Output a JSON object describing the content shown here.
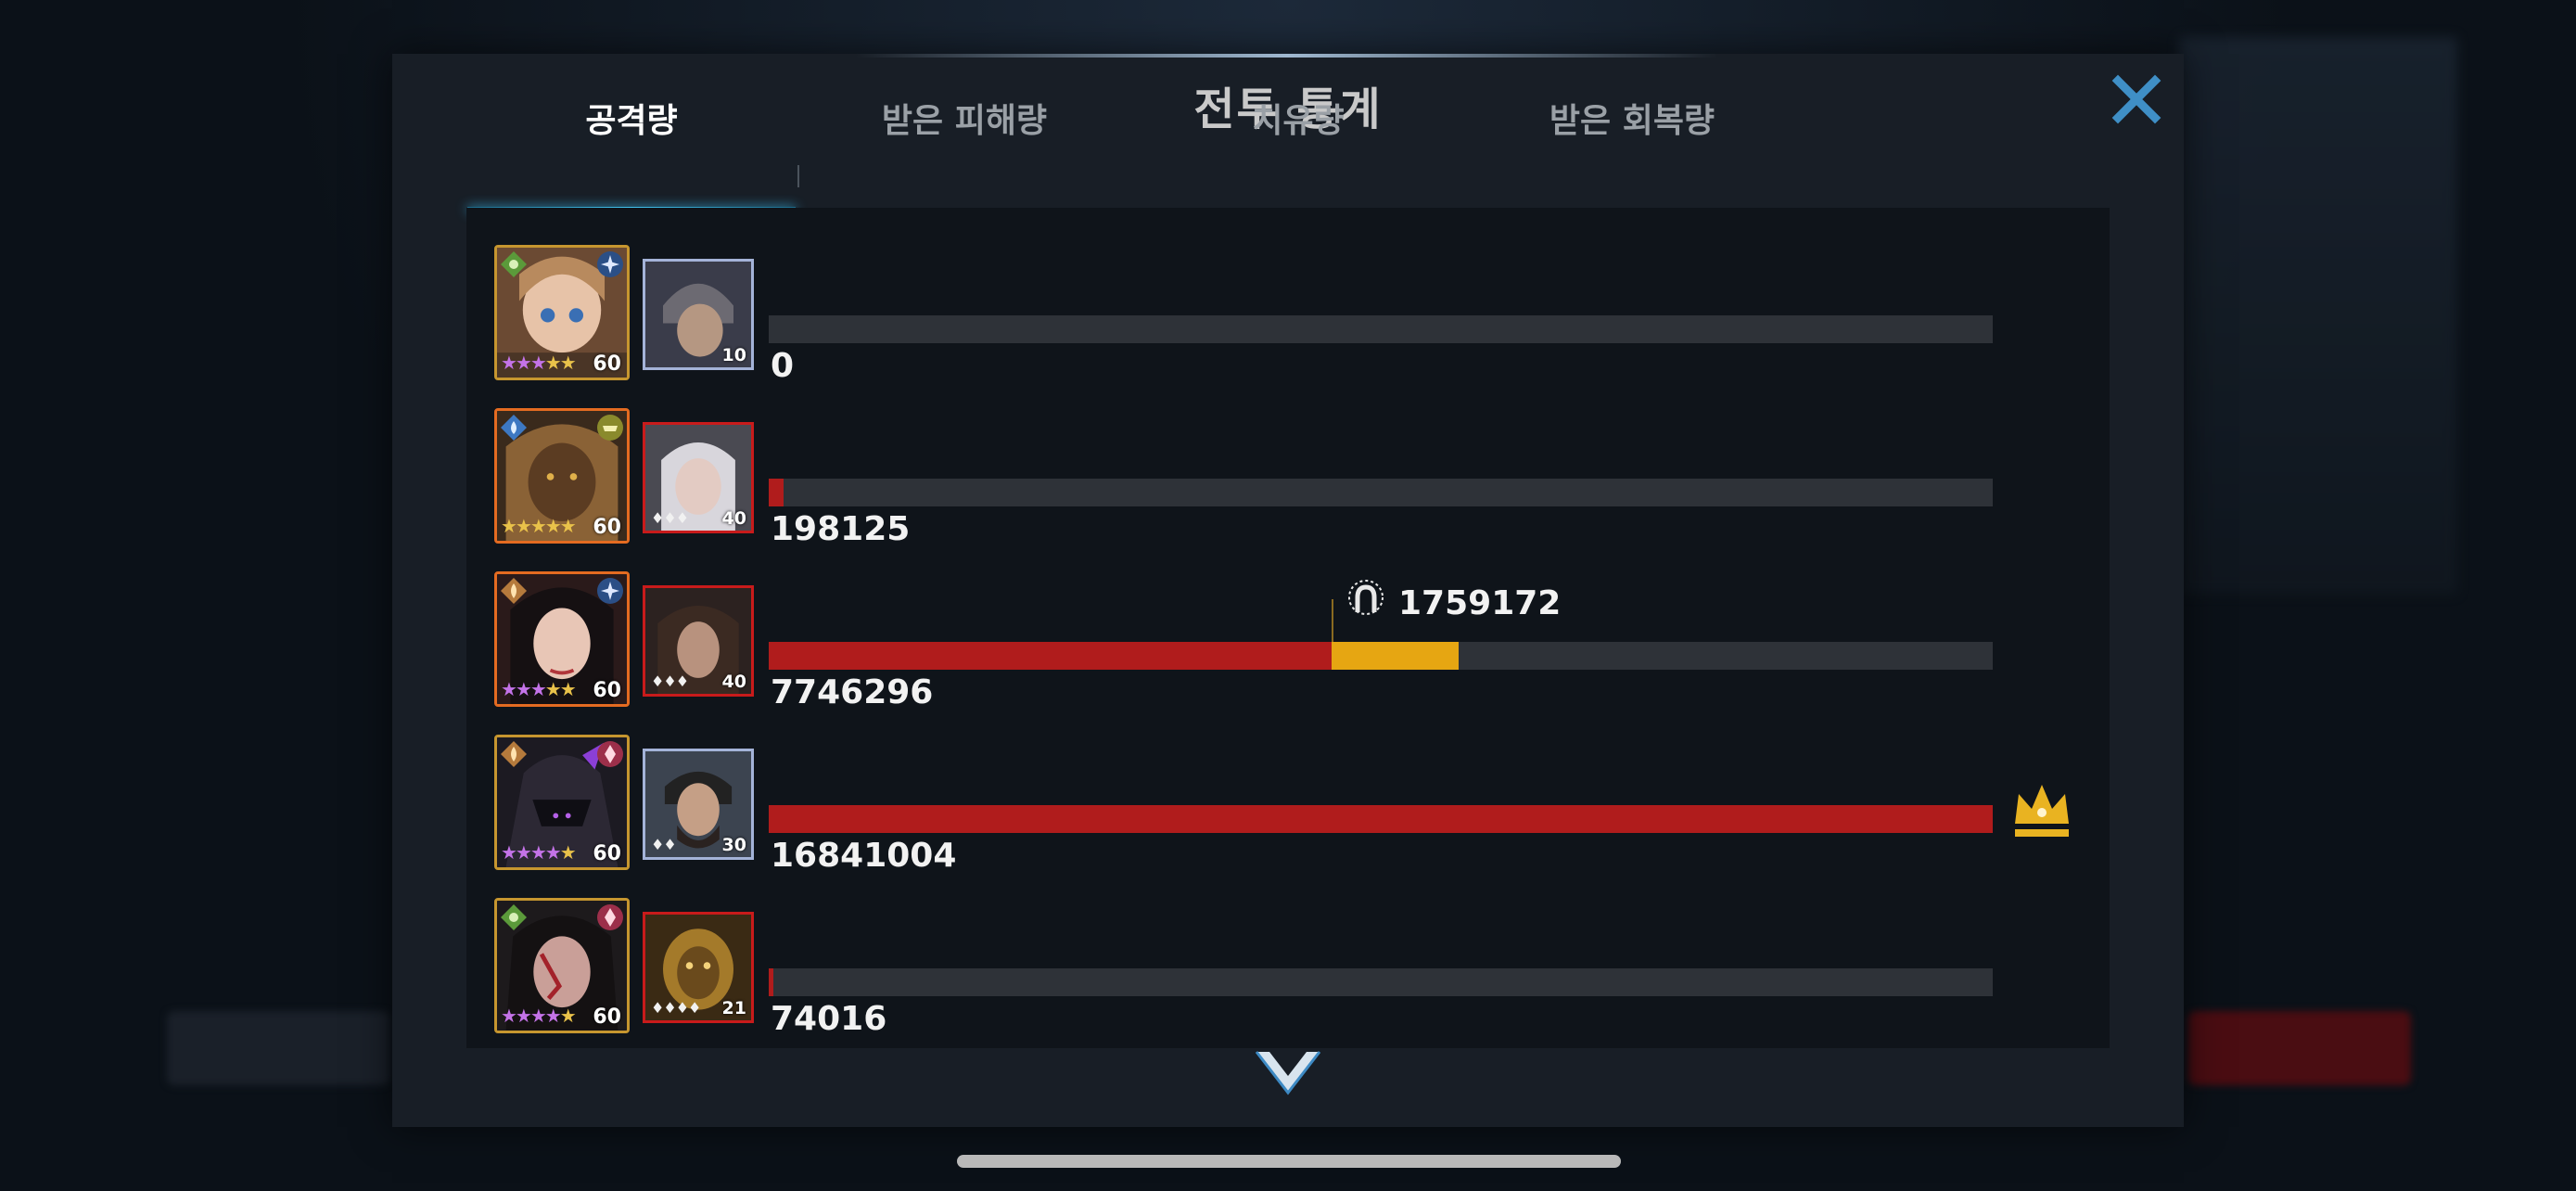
{
  "dialog": {
    "title": "전투 통계",
    "close_icon": "close-icon"
  },
  "tabs": [
    {
      "label": "공격량",
      "active": true
    },
    {
      "label": "받은 피해량",
      "active": false
    },
    {
      "label": "치유량",
      "active": false
    },
    {
      "label": "받은 회복량",
      "active": false
    }
  ],
  "colors": {
    "bar_main": "#b01c1c",
    "bar_extra": "#e6a612",
    "track": "#2e3238",
    "tab_accent": "#43c4f0",
    "crown": "#e9b321"
  },
  "rows": [
    {
      "hero_level": "60",
      "hero_stars": {
        "purple": 3,
        "gold": 2
      },
      "partner_level": "10",
      "partner_marks": "",
      "value": 0,
      "value_text": "0",
      "fraction": 0.0
    },
    {
      "hero_level": "60",
      "hero_stars": {
        "purple": 0,
        "gold": 5
      },
      "partner_level": "40",
      "partner_marks": "♦♦♦",
      "value": 198125,
      "value_text": "198125",
      "fraction": 0.012
    },
    {
      "hero_level": "60",
      "hero_stars": {
        "purple": 3,
        "gold": 2
      },
      "partner_level": "40",
      "partner_marks": "♦♦♦",
      "value": 7746296,
      "value_text": "7746296",
      "fraction": 0.46,
      "extra_value": 1759172,
      "extra_value_text": "1759172",
      "extra_fraction": 0.104,
      "extra_icon": "horseshoe-buff-icon"
    },
    {
      "hero_level": "60",
      "hero_stars": {
        "purple": 4,
        "gold": 1
      },
      "partner_level": "30",
      "partner_marks": "♦♦",
      "value": 16841004,
      "value_text": "16841004",
      "fraction": 1.0,
      "top_rank_icon": "crown-icon"
    },
    {
      "hero_level": "60",
      "hero_stars": {
        "purple": 4,
        "gold": 1
      },
      "partner_level": "21",
      "partner_marks": "♦♦♦♦",
      "value": 74016,
      "value_text": "74016",
      "fraction": 0.004
    }
  ],
  "scroll_icon": "chevron-down-icon"
}
